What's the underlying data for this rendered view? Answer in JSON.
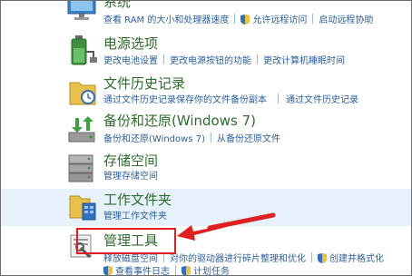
{
  "items": [
    {
      "title": "系统",
      "links": [
        "查看 RAM 的大小和处理器速度",
        "允许远程访问",
        "启动远程协助"
      ]
    },
    {
      "title": "电源选项",
      "links": [
        "更改电池设置",
        "更改电源按钮的功能",
        "更改计算机睡眠时间"
      ]
    },
    {
      "title": "文件历史记录",
      "links": [
        "通过文件历史记录保存你的文件备份副本",
        "通过文件历史记录"
      ]
    },
    {
      "title": "备份和还原(Windows 7)",
      "links": [
        "备份和还原(Windows 7)",
        "从备份还原文件"
      ]
    },
    {
      "title": "存储空间",
      "links": [
        "管理存储空间"
      ]
    },
    {
      "title": "工作文件夹",
      "links": [
        "管理工作文件夹"
      ]
    },
    {
      "title": "管理工具",
      "links": [
        "释放磁盘空间",
        "对你的驱动器进行碎片整理和优化",
        "创建并格式化"
      ],
      "links2": [
        "查看事件日志",
        "计划任务"
      ]
    }
  ],
  "colors": {
    "title": "#2f6b2f",
    "link": "#2b5f9e",
    "highlight_row": "#e6f1fb",
    "callout": "#e02020"
  }
}
